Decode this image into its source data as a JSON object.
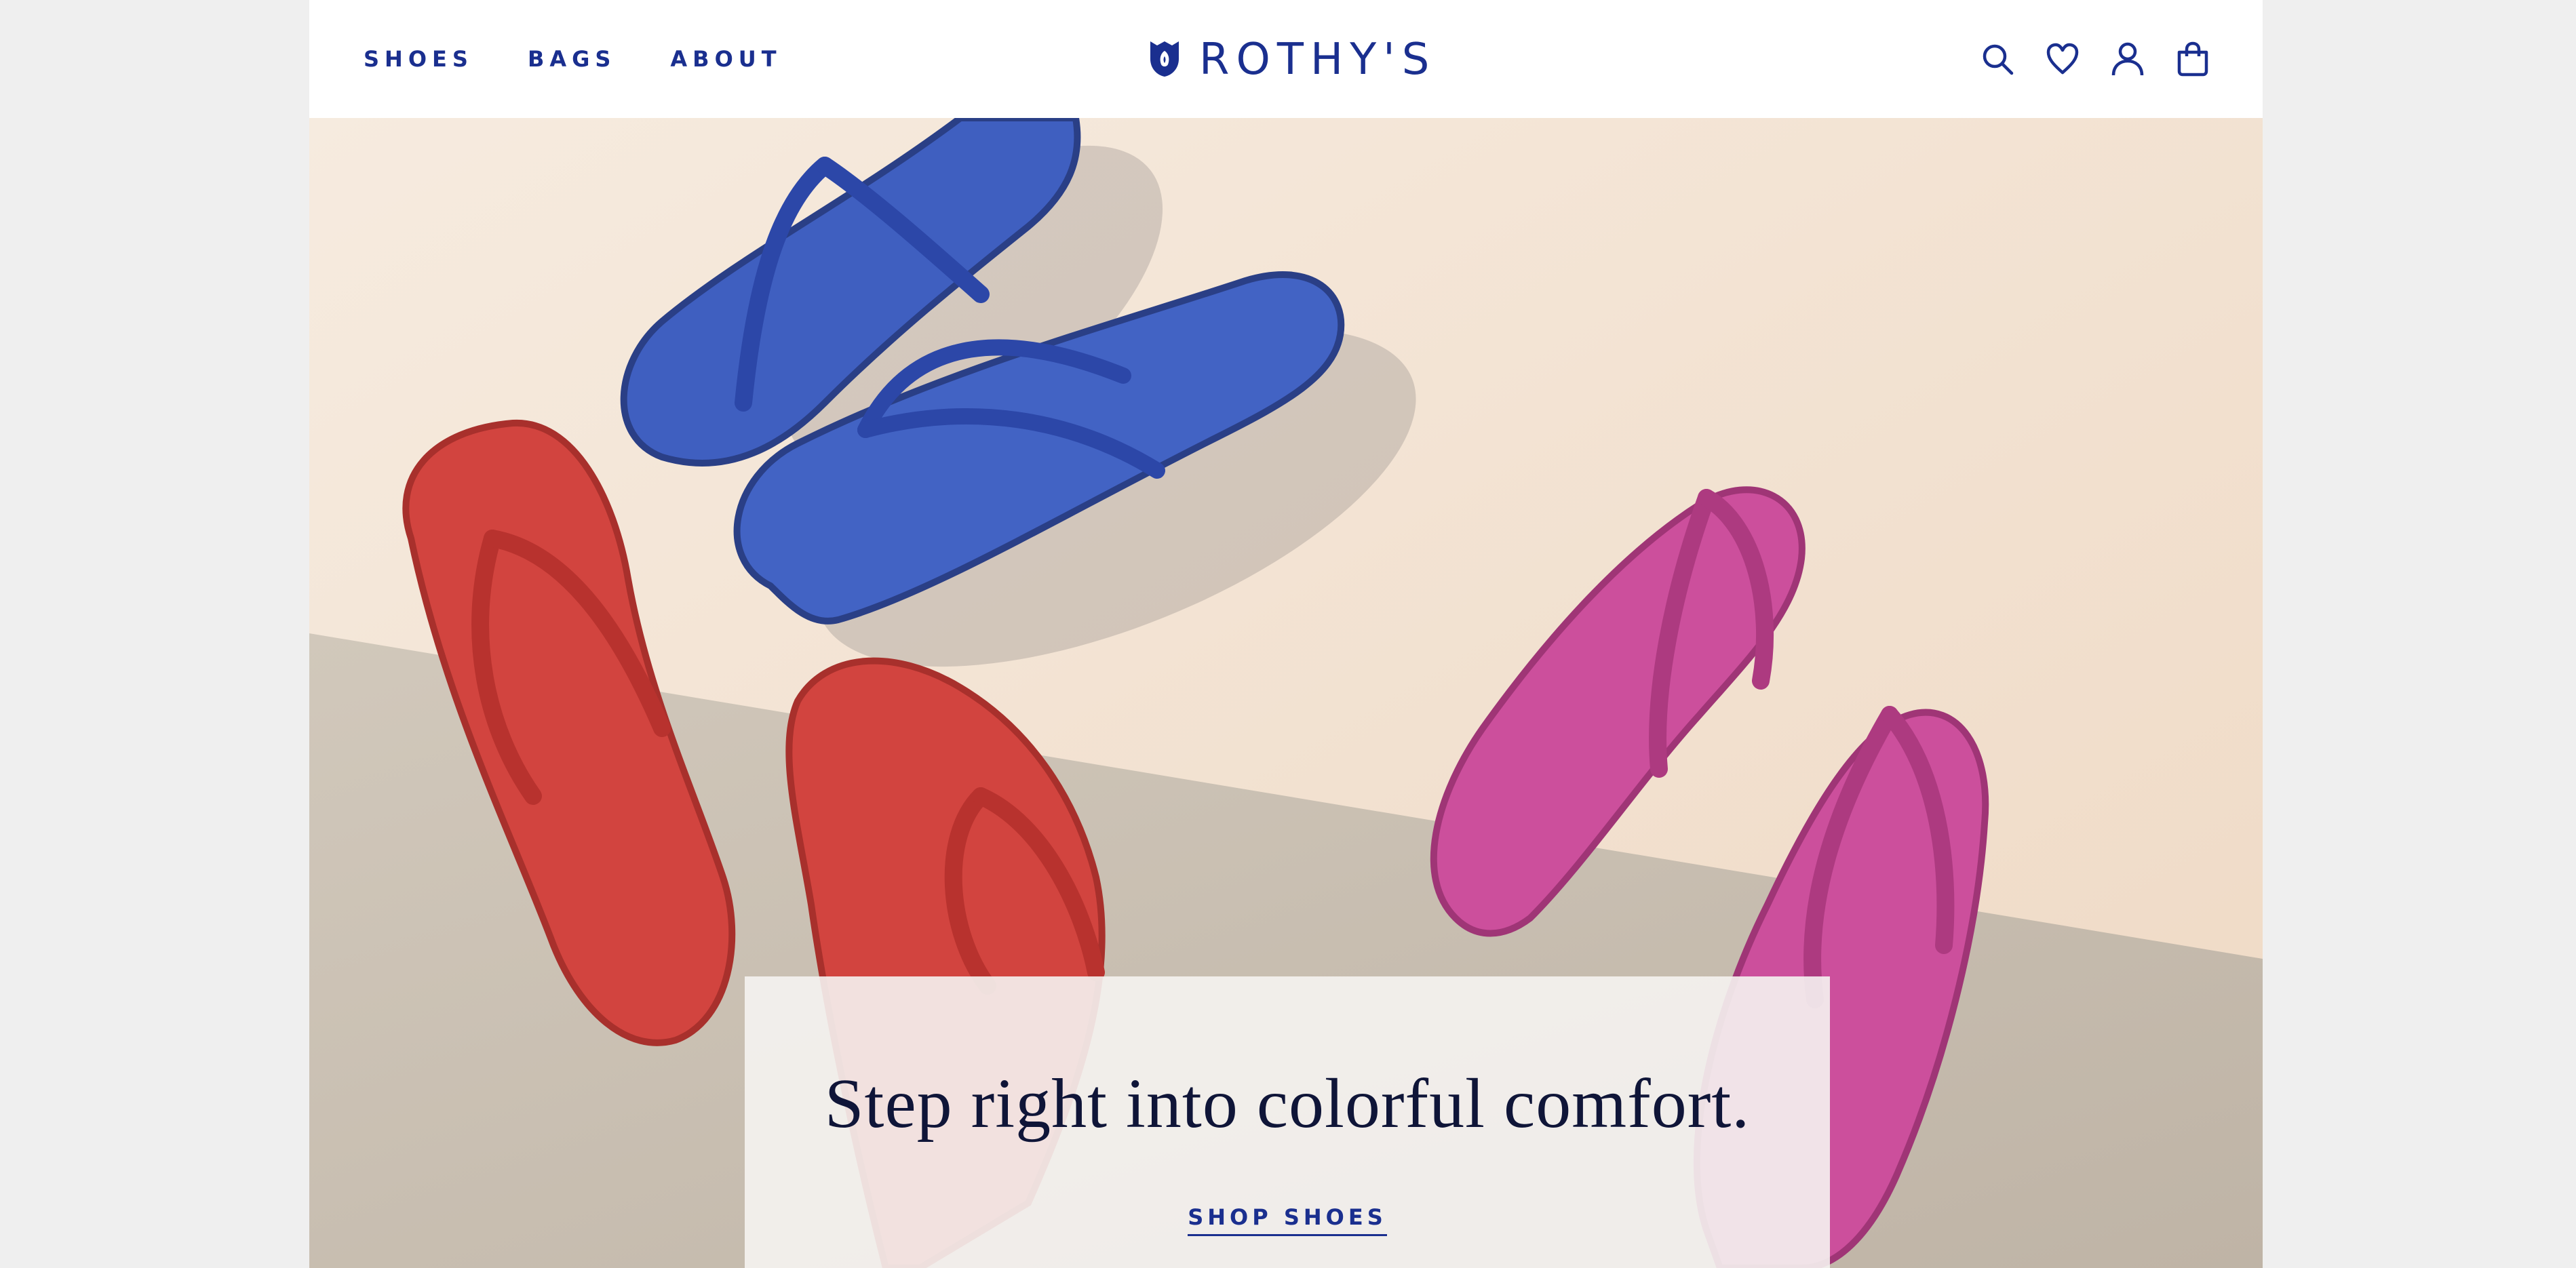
{
  "nav": {
    "items": [
      {
        "label": "SHOES"
      },
      {
        "label": "BAGS"
      },
      {
        "label": "ABOUT"
      }
    ]
  },
  "brand": {
    "name": "ROTHY'S",
    "logo_icon": "shield-icon"
  },
  "header_icons": [
    "search-icon",
    "heart-icon",
    "account-icon",
    "shopping-bag-icon"
  ],
  "hero": {
    "headline": "Step right into colorful comfort.",
    "cta_label": "SHOP SHOES",
    "colors": {
      "brand_blue": "#1a2f8f",
      "sandal_blue": "#3f5fc0",
      "sandal_red": "#d2443f",
      "sandal_pink": "#cc4f9c",
      "background_cream": "#f2e2d2",
      "background_concrete": "#c9c0b4"
    }
  }
}
